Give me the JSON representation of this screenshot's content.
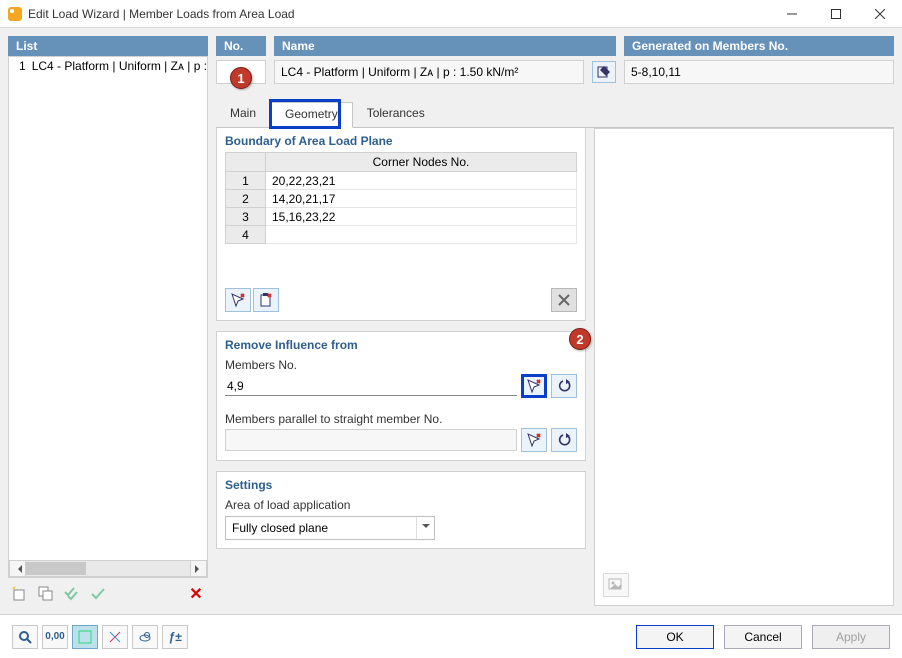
{
  "window": {
    "title": "Edit Load Wizard | Member Loads from Area Load"
  },
  "list": {
    "header": "List",
    "items": [
      {
        "num": "1",
        "text": "LC4 - Platform | Uniform | Zᴀ | p :"
      }
    ]
  },
  "top": {
    "no_label": "No.",
    "no_value": "",
    "name_label": "Name",
    "name_value": "LC4 - Platform | Uniform | Zᴀ | p : 1.50 kN/m²",
    "gen_label": "Generated on Members No.",
    "gen_value": "5-8,10,11"
  },
  "badges": {
    "one": "1",
    "two": "2"
  },
  "tabs": {
    "main": "Main",
    "geometry": "Geometry",
    "tolerances": "Tolerances"
  },
  "boundary": {
    "title": "Boundary of Area Load Plane",
    "col_header": "Corner Nodes No.",
    "rows": [
      {
        "idx": "1",
        "val": "20,22,23,21"
      },
      {
        "idx": "2",
        "val": "14,20,21,17"
      },
      {
        "idx": "3",
        "val": "15,16,23,22"
      },
      {
        "idx": "4",
        "val": ""
      }
    ]
  },
  "remove": {
    "title": "Remove Influence from",
    "members_label": "Members No.",
    "members_value": "4,9",
    "parallel_label": "Members parallel to straight member No.",
    "parallel_value": ""
  },
  "settings": {
    "title": "Settings",
    "area_label": "Area of load application",
    "area_value": "Fully closed plane"
  },
  "buttons": {
    "ok": "OK",
    "cancel": "Cancel",
    "apply": "Apply"
  }
}
